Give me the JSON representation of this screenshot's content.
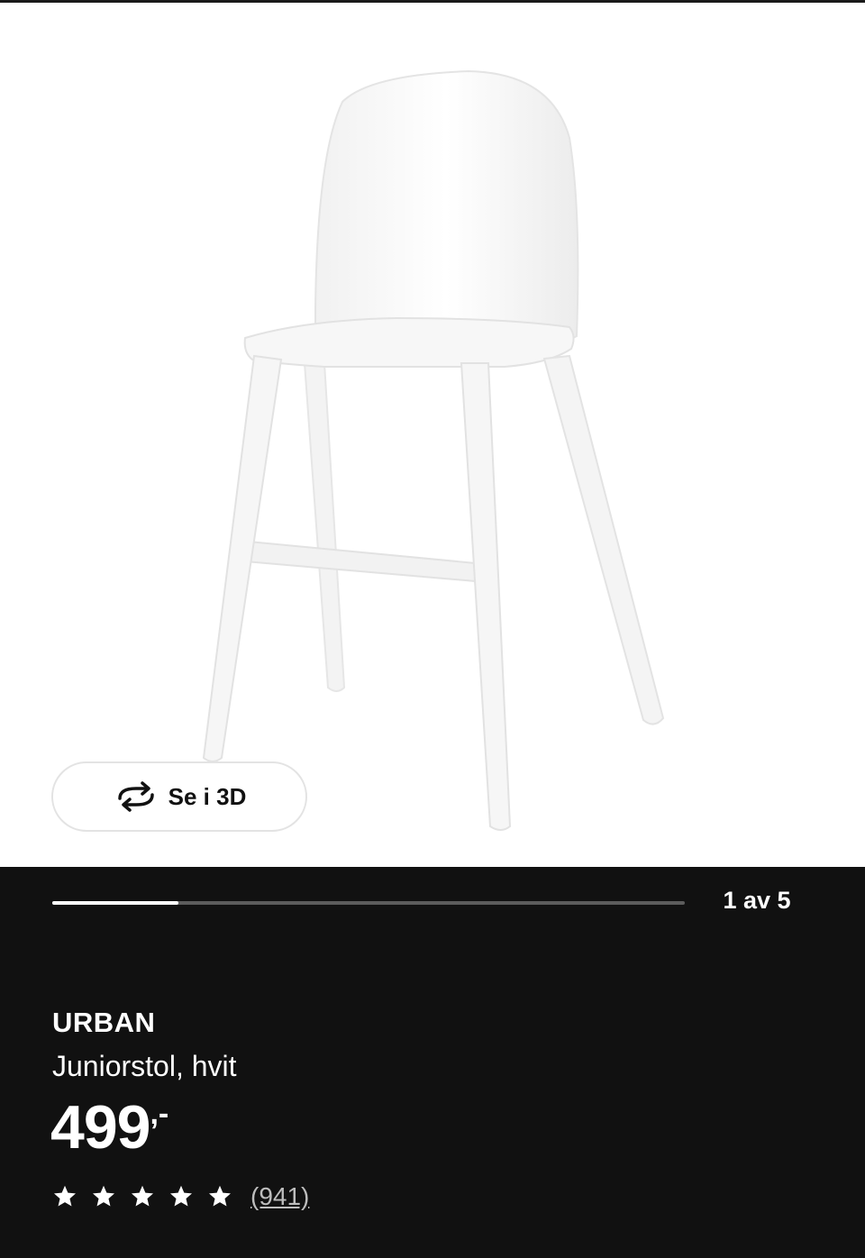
{
  "gallery": {
    "view_3d_label": "Se i 3D",
    "slide_counter": "1 av 5",
    "current_slide": 1,
    "total_slides": 5,
    "progress_fraction": 0.2
  },
  "product": {
    "name": "URBAN",
    "description": "Juniorstol, hvit",
    "price": "499",
    "price_suffix": ",-",
    "rating_stars": 5,
    "review_count": "(941)"
  },
  "icons": {
    "view_3d": "rotate-3d-icon",
    "star": "star-icon"
  },
  "colors": {
    "panel_background": "#111111",
    "image_background": "#ffffff",
    "progress_track": "#5c5c5c",
    "progress_fill": "#ffffff"
  }
}
